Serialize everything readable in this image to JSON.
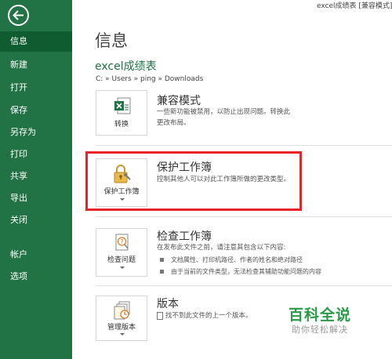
{
  "window_title": "excel成绩表 [兼容模式]",
  "sidebar": {
    "items": [
      {
        "label": "信息",
        "active": true
      },
      {
        "label": "新建"
      },
      {
        "label": "打开"
      },
      {
        "label": "保存"
      },
      {
        "label": "另存为"
      },
      {
        "label": "打印"
      },
      {
        "label": "共享"
      },
      {
        "label": "导出"
      },
      {
        "label": "关闭"
      },
      {
        "label": "帐户"
      },
      {
        "label": "选项"
      }
    ]
  },
  "main": {
    "title": "信息",
    "doc_name": "excel成绩表",
    "path": "C: » Users » ping » Downloads",
    "sections": {
      "compat": {
        "tile_label": "转换",
        "title": "兼容模式",
        "desc": [
          "一些新功能被禁用，以防止出现问题。转换此",
          "更改布局。"
        ]
      },
      "protect": {
        "tile_label": "保护工作簿",
        "title": "保护工作簿",
        "desc": [
          "控制其他人可以对此工作簿所做的更改类型。"
        ]
      },
      "inspect": {
        "tile_label": "检查问题",
        "title": "检查工作簿",
        "desc": [
          "在发布此文件之前，请注意其包含以下内容:"
        ],
        "bullets": [
          "文档属性、打印机路径、作者的姓名和绝对路径",
          "由于当前的文件类型，无法检查其辅助功能问题的内容"
        ]
      },
      "versions": {
        "tile_label": "管理版本",
        "title": "版本",
        "desc": [
          "找不到此文件的上一个版本。"
        ]
      }
    }
  },
  "watermark": {
    "title": "百科全说",
    "subtitle": "助你轻松解决"
  },
  "colors": {
    "sidebar": "#217346",
    "sidebar_active": "#0e5c2f",
    "accent": "#217346",
    "highlight": "#e8232a"
  }
}
